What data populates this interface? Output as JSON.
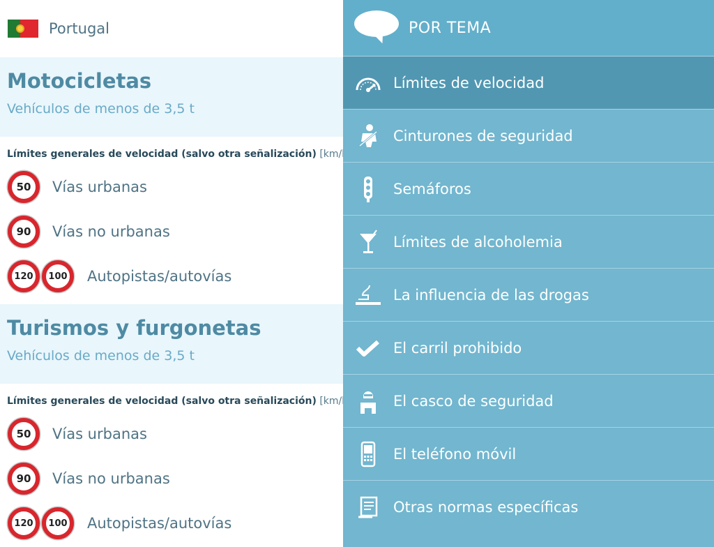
{
  "country": {
    "name": "Portugal"
  },
  "sections": [
    {
      "title": "Motocicletas",
      "subtitle": "Vehículos de menos de 3,5 t",
      "limits_heading": "Límites generales de velocidad (salvo otra señalización)",
      "limits_unit": "[km/h]",
      "rows": [
        {
          "signs": [
            "50"
          ],
          "label": "Vías urbanas"
        },
        {
          "signs": [
            "90"
          ],
          "label": "Vías no urbanas"
        },
        {
          "signs": [
            "120",
            "100"
          ],
          "label": "Autopistas/autovías"
        }
      ]
    },
    {
      "title": "Turismos y furgonetas",
      "subtitle": "Vehículos de menos de 3,5 t",
      "limits_heading": "Límites generales de velocidad (salvo otra señalización)",
      "limits_unit": "[km/h]",
      "rows": [
        {
          "signs": [
            "50"
          ],
          "label": "Vías urbanas"
        },
        {
          "signs": [
            "90"
          ],
          "label": "Vías no urbanas"
        },
        {
          "signs": [
            "120",
            "100"
          ],
          "label": "Autopistas/autovías"
        }
      ]
    }
  ],
  "menu": {
    "title": "POR TEMA",
    "items": [
      {
        "label": "Límites de velocidad",
        "icon": "speedometer-icon",
        "active": true
      },
      {
        "label": "Cinturones de seguridad",
        "icon": "seatbelt-icon"
      },
      {
        "label": "Semáforos",
        "icon": "traffic-light-icon"
      },
      {
        "label": "Límites de alcoholemia",
        "icon": "cocktail-icon"
      },
      {
        "label": "La influencia de las drogas",
        "icon": "cigarette-icon"
      },
      {
        "label": "El carril prohibido",
        "icon": "checkmark-icon"
      },
      {
        "label": "El casco de seguridad",
        "icon": "helmet-rider-icon"
      },
      {
        "label": "El teléfono móvil",
        "icon": "mobile-phone-icon"
      },
      {
        "label": "Otras normas específicas",
        "icon": "document-icon"
      }
    ]
  },
  "colors": {
    "sign_border": "#d8262d",
    "menu_bg": "#72b6cf",
    "menu_active": "#5197b2",
    "section_bg": "#e9f6fc",
    "title_text": "#4e8aa3"
  }
}
